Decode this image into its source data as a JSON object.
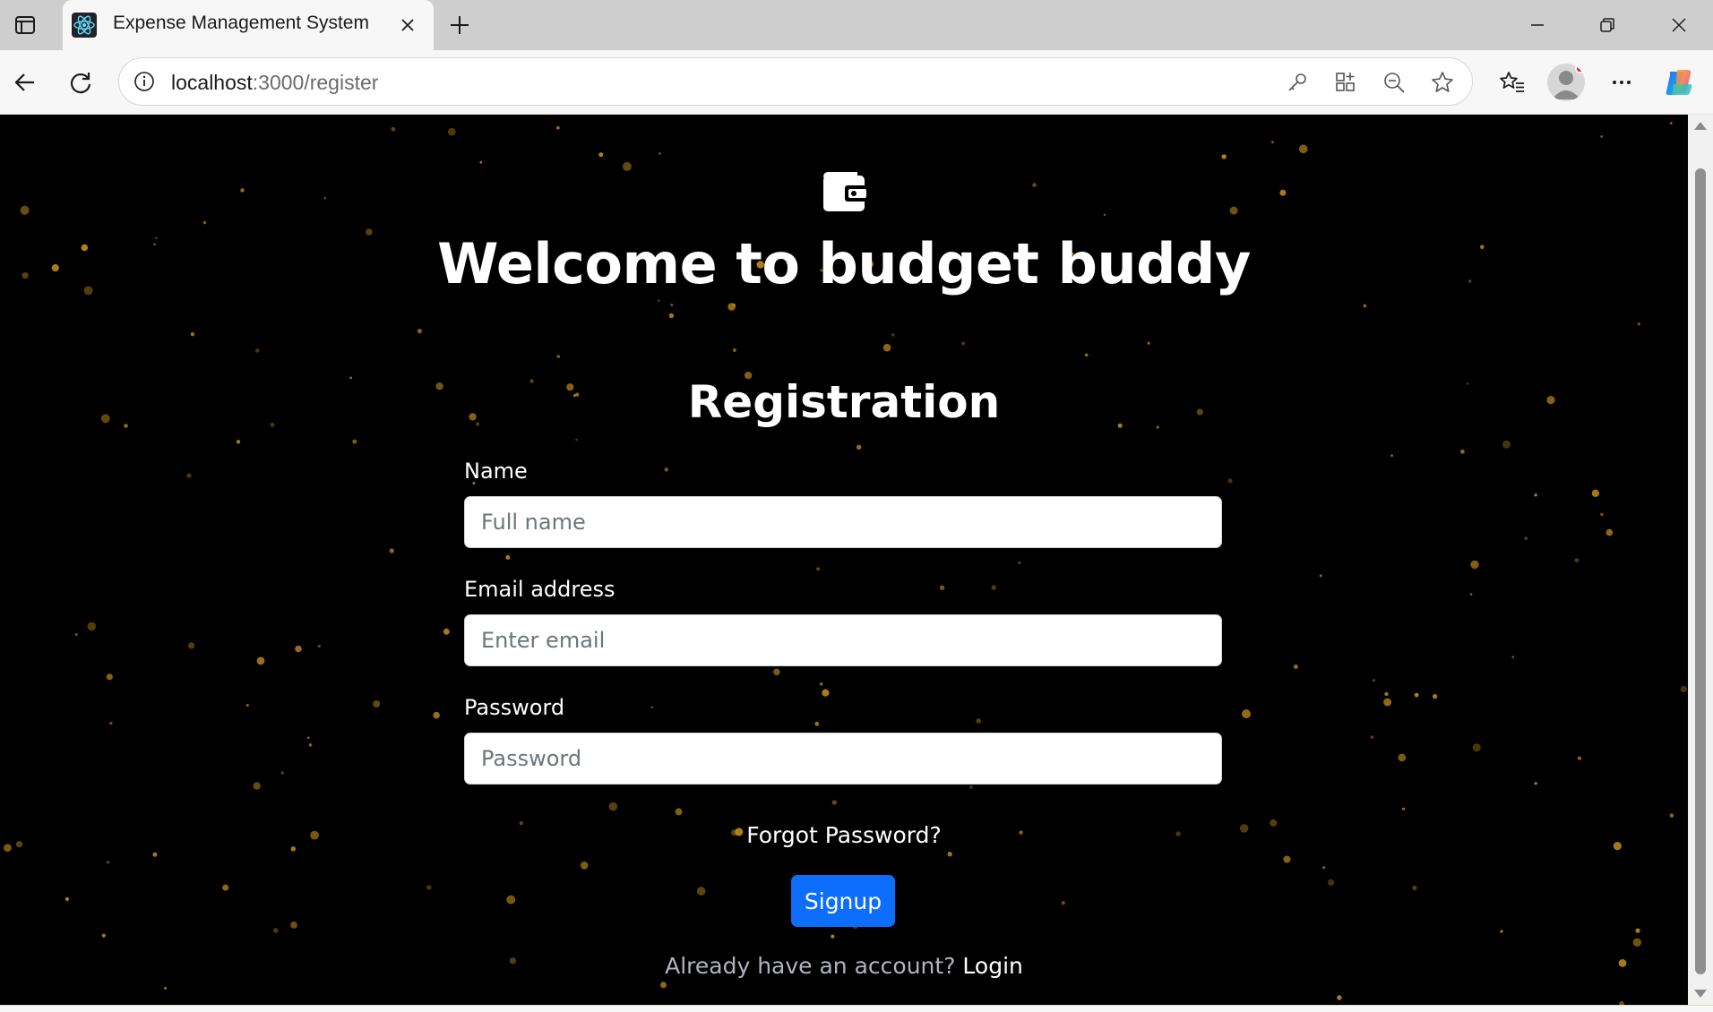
{
  "browser": {
    "tab_title": "Expense Management System",
    "url_host": "localhost",
    "url_path": ":3000/register"
  },
  "page": {
    "heading": "Welcome to budget buddy",
    "form_title": "Registration",
    "fields": {
      "name": {
        "label": "Name",
        "placeholder": "Full name",
        "value": ""
      },
      "email": {
        "label": "Email address",
        "placeholder": "Enter email",
        "value": ""
      },
      "password": {
        "label": "Password",
        "placeholder": "Password",
        "value": ""
      }
    },
    "forgot_password": "Forgot Password?",
    "signup_label": "Signup",
    "login_prompt": "Already have an account?",
    "login_link": "Login"
  },
  "colors": {
    "background": "#000000",
    "star": "#c8911b",
    "primary_button": "#0d6efd"
  },
  "icons": {
    "logo": "wallet-icon",
    "favicon": "react-icon"
  }
}
